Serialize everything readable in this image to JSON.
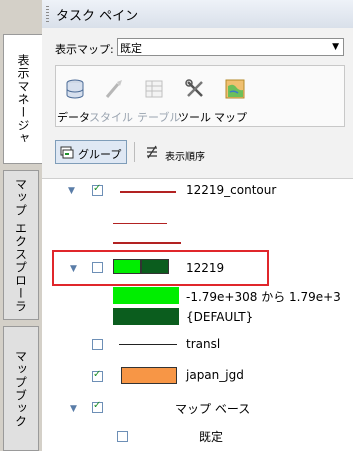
{
  "panel_title": "タスク ペイン",
  "vertical_tabs": [
    "表示マネージャ",
    "マップ エクスプローラ",
    "マップブック"
  ],
  "display_map": {
    "label": "表示マップ:",
    "value": "既定"
  },
  "toolbar": {
    "data": "データ",
    "style": "スタイル",
    "table": "テーブル",
    "tools": "ツール",
    "map": "マップ"
  },
  "view_tabs": {
    "group": "グループ",
    "draw_order": "表示順序"
  },
  "layers": [
    {
      "name": "12219_contour",
      "checked": true,
      "expanded": true,
      "color": "#b22222"
    },
    {
      "name": "12219",
      "checked": false,
      "expanded": true,
      "legend": [
        {
          "color": "#00ee00",
          "label": "-1.79e+308 から 1.79e+3"
        },
        {
          "color": "#0b5d1e",
          "label": "{DEFAULT}"
        }
      ]
    },
    {
      "name": "transl",
      "checked": false,
      "color": "#222222"
    },
    {
      "name": "japan_jgd",
      "checked": true,
      "color": "#f79646"
    },
    {
      "name": "マップ ベース",
      "checked": true,
      "expanded": true
    },
    {
      "name": "既定",
      "checked": false
    }
  ]
}
